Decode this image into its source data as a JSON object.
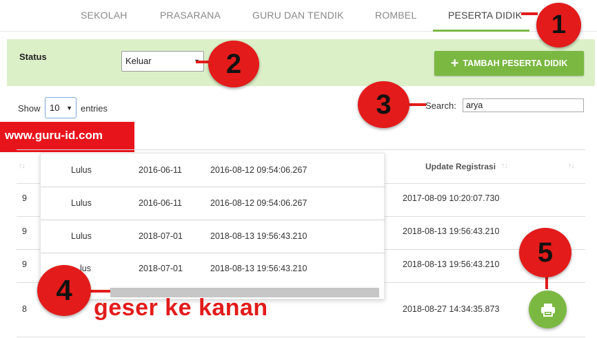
{
  "nav": {
    "tabs": [
      {
        "label": "SEKOLAH"
      },
      {
        "label": "PRASARANA"
      },
      {
        "label": "GURU DAN TENDIK"
      },
      {
        "label": "ROMBEL"
      },
      {
        "label": "PESERTA DIDIK"
      }
    ],
    "active_tab": "PESERTA DIDIK"
  },
  "status_bar": {
    "label": "Status",
    "selected": "Keluar",
    "add_button": "TAMBAH PESERTA DIDIK"
  },
  "table_controls": {
    "show_label": "Show",
    "page_size": "10",
    "entries_label": "entries",
    "search_label": "Search:",
    "search_value": "arya"
  },
  "watermark": "www.guru-id.com",
  "table": {
    "header_update": "Update Registrasi",
    "rows": [
      {
        "left": "9",
        "update": "2017-08-09 10:20:07.730"
      },
      {
        "left": "9",
        "update": "2018-08-13 19:56:43.210"
      },
      {
        "left": "9",
        "update": "2018-08-13 19:56:43.210"
      },
      {
        "left": "8",
        "update": "2018-08-27 14:34:35.873"
      }
    ]
  },
  "overlay_rows": [
    {
      "status": "Lulus",
      "date": "2016-06-11",
      "timestamp": "2016-08-12 09:54:06.267"
    },
    {
      "status": "Lulus",
      "date": "2016-06-11",
      "timestamp": "2016-08-12 09:54:06.267"
    },
    {
      "status": "Lulus",
      "date": "2018-07-01",
      "timestamp": "2018-08-13 19:56:43.210"
    },
    {
      "status": "lus",
      "date": "2018-07-01",
      "timestamp": "2018-08-13 19:56:43.210"
    }
  ],
  "annotations": {
    "badge1": "1",
    "badge2": "2",
    "badge3": "3",
    "badge4": "4",
    "badge5": "5",
    "hint": "geser ke kanan"
  },
  "colors": {
    "accent_green": "#7bb842",
    "status_bg": "#dcf0c8",
    "annotation_red": "#e31b1b"
  },
  "icons": {
    "add": "plus-icon",
    "print": "printer-icon",
    "sort": "sort-icon",
    "dropdown": "caret-down-icon"
  }
}
